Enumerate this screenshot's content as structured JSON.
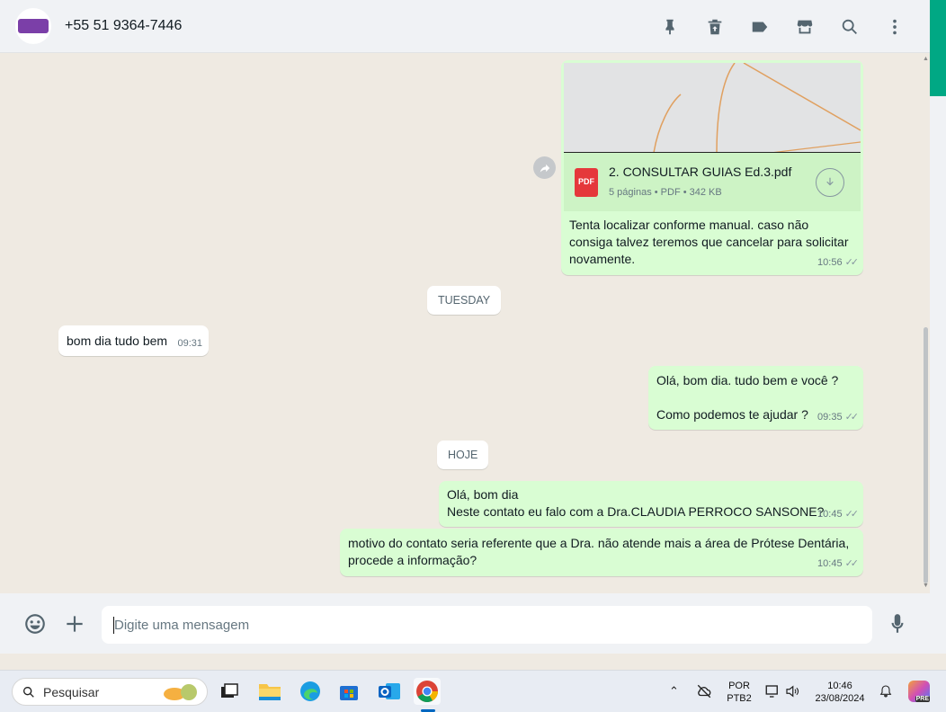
{
  "header": {
    "contact_name": "+55 51 9364-7446",
    "icons": [
      "pin-icon",
      "archive-icon",
      "label-icon",
      "store-icon",
      "search-icon",
      "more-icon"
    ]
  },
  "messages": {
    "doc": {
      "file_name": "2. CONSULTAR GUIAS Ed.3.pdf",
      "file_meta": "5 páginas • PDF • 342 KB",
      "pdf_label": "PDF",
      "caption": "Tenta localizar conforme manual. caso não consiga talvez teremos que cancelar para solicitar novamente.",
      "time": "10:56"
    },
    "date1": "TUESDAY",
    "in1": {
      "text": "bom dia tudo bem",
      "time": "09:31"
    },
    "out1": {
      "line1": "Olá, bom dia. tudo bem e você ?",
      "line2": "Como podemos te ajudar ?",
      "time": "09:35"
    },
    "date2": "HOJE",
    "out2": {
      "line1": "Olá, bom dia",
      "line2": "Neste contato eu falo com a Dra.CLAUDIA PERROCO SANSONE?",
      "time": "10:45"
    },
    "out3": {
      "text": "motivo do contato seria referente que a Dra. não atende mais a área de Prótese Dentária, procede a informação?",
      "time": "10:45"
    }
  },
  "composer": {
    "placeholder": "Digite uma mensagem"
  },
  "taskbar": {
    "search_label": "Pesquisar",
    "lang_line1": "POR",
    "lang_line2": "PTB2",
    "clock_time": "10:46",
    "clock_date": "23/08/2024",
    "copilot_badge": "PRE"
  },
  "colors": {
    "accent": "#00a884",
    "outgoing_bubble": "#d9fdd3",
    "chat_background": "#efeae2"
  }
}
